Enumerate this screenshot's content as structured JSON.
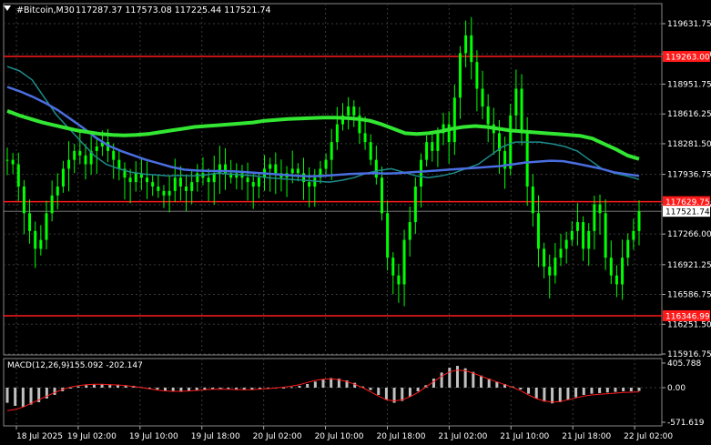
{
  "header": {
    "symbol": "#Bitcoin,M30",
    "ohlc": "117287.37 117573.08 117225.44 117521.74"
  },
  "macd": {
    "title": "MACD(12,26,9)",
    "values": "-155.092 -202.147",
    "scale": [
      "405.788",
      "0.00",
      "-571.619"
    ]
  },
  "colors": {
    "bg": "#000000",
    "grid": "#3a3a3a",
    "candle": "#00ff00",
    "ma_fast": "#1e8c8c",
    "ma_mid": "#4a6ee0",
    "ma_slow": "#32e632",
    "level_line": "#ff1a1a",
    "hist": "#c0c0c0",
    "signal": "#ff1a1a"
  },
  "chart_data": {
    "type": "candlestick",
    "y_ticks": [
      "119631.75",
      "119291.00",
      "118951.75",
      "118616.25",
      "118281.50",
      "117936.75",
      "117596.25",
      "117266.00",
      "116921.25",
      "116586.75",
      "116251.50",
      "115916.75"
    ],
    "ylim": [
      115916.75,
      119631.75
    ],
    "x_ticks": [
      "18 Jul 2025",
      "19 Jul 02:00",
      "19 Jul 10:00",
      "19 Jul 18:00",
      "20 Jul 02:00",
      "20 Jul 10:00",
      "20 Jul 18:00",
      "21 Jul 02:00",
      "21 Jul 10:00",
      "21 Jul 18:00",
      "22 Jul 02:00"
    ],
    "levels": [
      {
        "label": "119263.00",
        "value": 119263.0
      },
      {
        "label": "117629.75",
        "value": 117629.75
      },
      {
        "label": "116346.99",
        "value": 116346.99
      }
    ],
    "current_price": {
      "label": "117521.74",
      "value": 117521.74
    },
    "close_series": [
      118100,
      118050,
      117800,
      117500,
      117300,
      117100,
      117200,
      117500,
      117700,
      117800,
      118000,
      118100,
      118200,
      118150,
      118050,
      118200,
      118250,
      118300,
      118200,
      118100,
      118000,
      117900,
      117850,
      117950,
      117900,
      117850,
      117800,
      117750,
      117700,
      117750,
      117900,
      117800,
      117750,
      117850,
      117950,
      117900,
      117850,
      117950,
      118050,
      117950,
      117900,
      117950,
      117900,
      117850,
      117800,
      117900,
      118000,
      118050,
      117950,
      117900,
      117950,
      118000,
      117950,
      117850,
      117800,
      117900,
      118000,
      118100,
      118300,
      118500,
      118600,
      118700,
      118600,
      118400,
      118300,
      118100,
      117900,
      117500,
      117000,
      116800,
      116700,
      117200,
      117400,
      117800,
      118100,
      118300,
      118200,
      118400,
      118500,
      118300,
      118800,
      119300,
      119500,
      119200,
      118900,
      118700,
      118500,
      118400,
      118200,
      118000,
      118600,
      118900,
      118400,
      117800,
      117500,
      117100,
      116900,
      116800,
      117000,
      117100,
      117200,
      117300,
      117400,
      117100,
      117300,
      117600,
      117500,
      117000,
      116800,
      116700,
      117000,
      117200,
      117300,
      117521
    ],
    "ma_slow": [
      118650,
      118600,
      118560,
      118520,
      118490,
      118460,
      118430,
      118410,
      118390,
      118380,
      118375,
      118380,
      118390,
      118410,
      118430,
      118450,
      118470,
      118480,
      118490,
      118500,
      118510,
      118520,
      118540,
      118550,
      118560,
      118565,
      118570,
      118575,
      118575,
      118570,
      118560,
      118540,
      118500,
      118450,
      118400,
      118390,
      118400,
      118420,
      118450,
      118470,
      118480,
      118470,
      118450,
      118430,
      118420,
      118410,
      118400,
      118390,
      118380,
      118370,
      118340,
      118280,
      118220,
      118150,
      118110
    ],
    "ma_mid": [
      118920,
      118870,
      118810,
      118740,
      118660,
      118560,
      118460,
      118350,
      118260,
      118200,
      118150,
      118100,
      118060,
      118020,
      117990,
      117980,
      117975,
      117975,
      117970,
      117960,
      117950,
      117940,
      117930,
      117920,
      117915,
      117920,
      117930,
      117940,
      117945,
      117950,
      117945,
      117950,
      117960,
      117970,
      117980,
      117990,
      118000,
      118010,
      118020,
      118030,
      118050,
      118070,
      118080,
      118090,
      118085,
      118060,
      118030,
      118000,
      117960,
      117940,
      117920
    ],
    "ma_fast": [
      119150,
      119100,
      119000,
      118800,
      118600,
      118450,
      118300,
      118150,
      118050,
      118000,
      117960,
      117940,
      117930,
      117920,
      117925,
      117920,
      117930,
      117950,
      117940,
      117930,
      117920,
      117900,
      117890,
      117880,
      117870,
      117860,
      117850,
      117870,
      117900,
      117950,
      117980,
      118000,
      117960,
      117920,
      117900,
      117920,
      117950,
      118000,
      118050,
      118150,
      118250,
      118300,
      118300,
      118300,
      118280,
      118250,
      118200,
      118100,
      118000,
      117950,
      117920,
      117880
    ],
    "macd_hist": [
      -250,
      -300,
      -320,
      -280,
      -240,
      -180,
      -120,
      -60,
      0,
      20,
      40,
      50,
      60,
      55,
      50,
      40,
      30,
      10,
      -10,
      -30,
      -50,
      -60,
      -70,
      -60,
      -50,
      -40,
      -30,
      -20,
      -20,
      -30,
      -40,
      -40,
      -30,
      -20,
      -10,
      0,
      10,
      30,
      60,
      100,
      140,
      160,
      150,
      120,
      80,
      20,
      -40,
      -120,
      -200,
      -250,
      -220,
      -150,
      -60,
      40,
      150,
      250,
      330,
      360,
      320,
      260,
      200,
      150,
      100,
      60,
      20,
      -30,
      -100,
      -180,
      -230,
      -260,
      -240,
      -200,
      -160,
      -120,
      -100,
      -90,
      -80,
      -70,
      -60,
      -60,
      -55
    ],
    "macd_signal": [
      -380,
      -360,
      -320,
      -260,
      -200,
      -140,
      -80,
      -30,
      10,
      35,
      50,
      55,
      55,
      50,
      45,
      35,
      20,
      0,
      -20,
      -40,
      -55,
      -60,
      -60,
      -55,
      -45,
      -35,
      -28,
      -25,
      -28,
      -32,
      -35,
      -32,
      -25,
      -15,
      -5,
      8,
      25,
      50,
      85,
      120,
      140,
      145,
      130,
      100,
      55,
      0,
      -70,
      -140,
      -200,
      -220,
      -200,
      -150,
      -80,
      10,
      100,
      190,
      260,
      290,
      280,
      240,
      190,
      140,
      95,
      50,
      5,
      -50,
      -120,
      -180,
      -220,
      -240,
      -230,
      -200,
      -170,
      -140,
      -120,
      -110,
      -100,
      -90,
      -80,
      -75,
      -70
    ]
  }
}
